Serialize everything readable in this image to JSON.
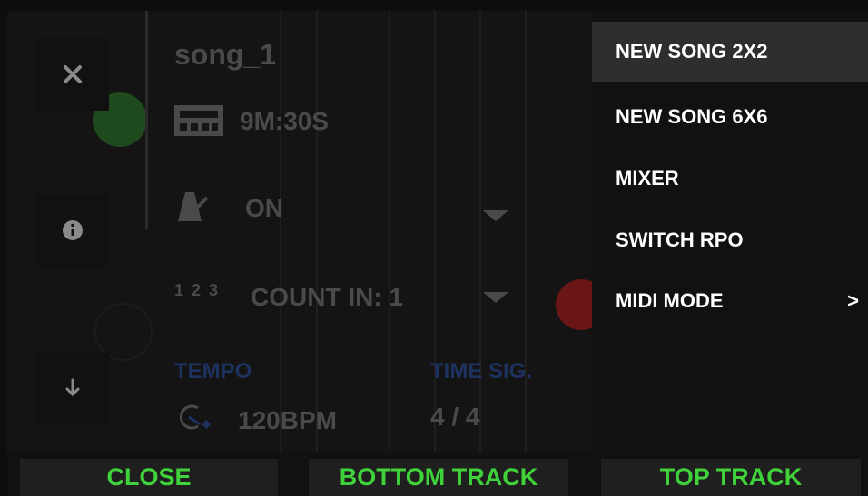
{
  "panel": {
    "song_name": "song_1",
    "duration": "9M:30S",
    "metronome_value": "ON",
    "count_in_icon": "1 2 3",
    "count_in_value": "COUNT IN: 1",
    "tempo_label": "TEMPO",
    "tempo_value": "120BPM",
    "time_sig_label": "TIME SIG.",
    "time_sig_value": "4 / 4"
  },
  "side_buttons": {
    "close_icon": "close-icon",
    "info_icon": "info-icon",
    "down_icon": "arrow-down-icon"
  },
  "menu": {
    "items": [
      {
        "label": "NEW SONG 2X2",
        "active": true
      },
      {
        "label": "NEW SONG 6X6",
        "active": false
      },
      {
        "label": "MIXER",
        "active": false
      },
      {
        "label": "SWITCH RPO",
        "active": false
      },
      {
        "label": "MIDI MODE",
        "active": false,
        "submenu_arrow": ">"
      }
    ]
  },
  "bottom_bar": {
    "close_label": "CLOSE",
    "bottom_track_label": "BOTTOM TRACK",
    "top_track_label": "TOP TRACK"
  },
  "colors": {
    "accent_green": "#3fd23a",
    "dim_blue": "#1e3260",
    "menu_bg": "#111111",
    "menu_active": "#2e2e2e"
  }
}
